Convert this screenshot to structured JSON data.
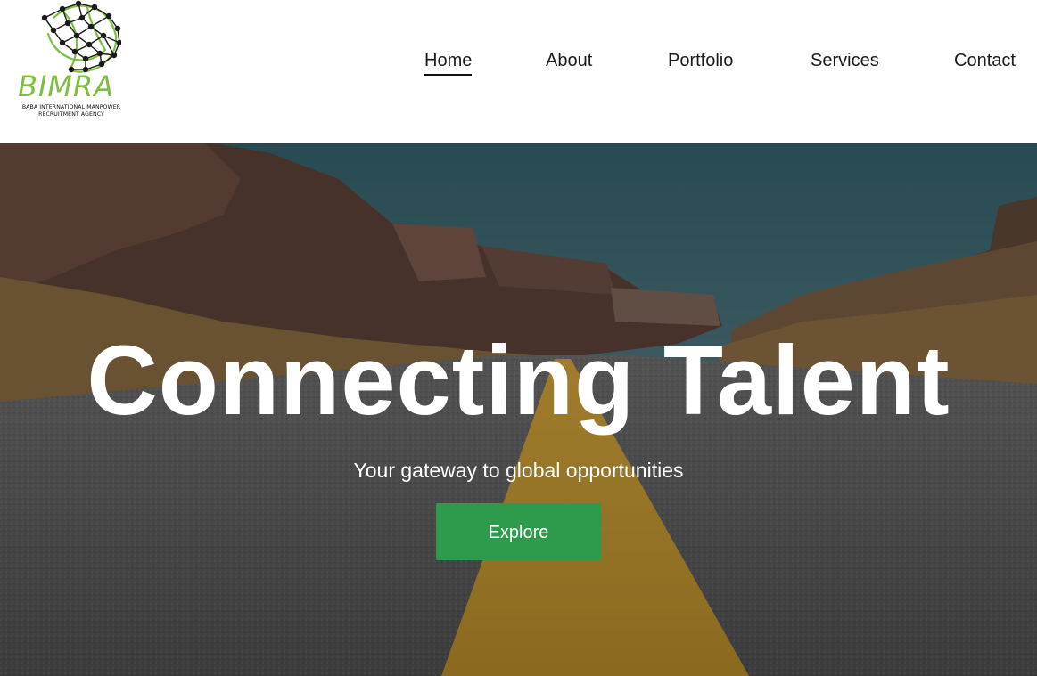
{
  "brand": {
    "name": "BIMRA",
    "tagline_line1": "BABA INTERNATIONAL MANPOWER",
    "tagline_line2": "RECRUITMENT AGENCY",
    "color_green": "#7fbf3f",
    "color_dark": "#1b1b1b"
  },
  "nav": {
    "items": [
      {
        "label": "Home",
        "active": true
      },
      {
        "label": "About",
        "active": false
      },
      {
        "label": "Portfolio",
        "active": false
      },
      {
        "label": "Services",
        "active": false
      },
      {
        "label": "Contact",
        "active": false
      }
    ]
  },
  "hero": {
    "title": "Connecting Talent",
    "subtitle": "Your gateway to global opportunities",
    "button_label": "Explore",
    "button_color": "#2e9b4c"
  }
}
